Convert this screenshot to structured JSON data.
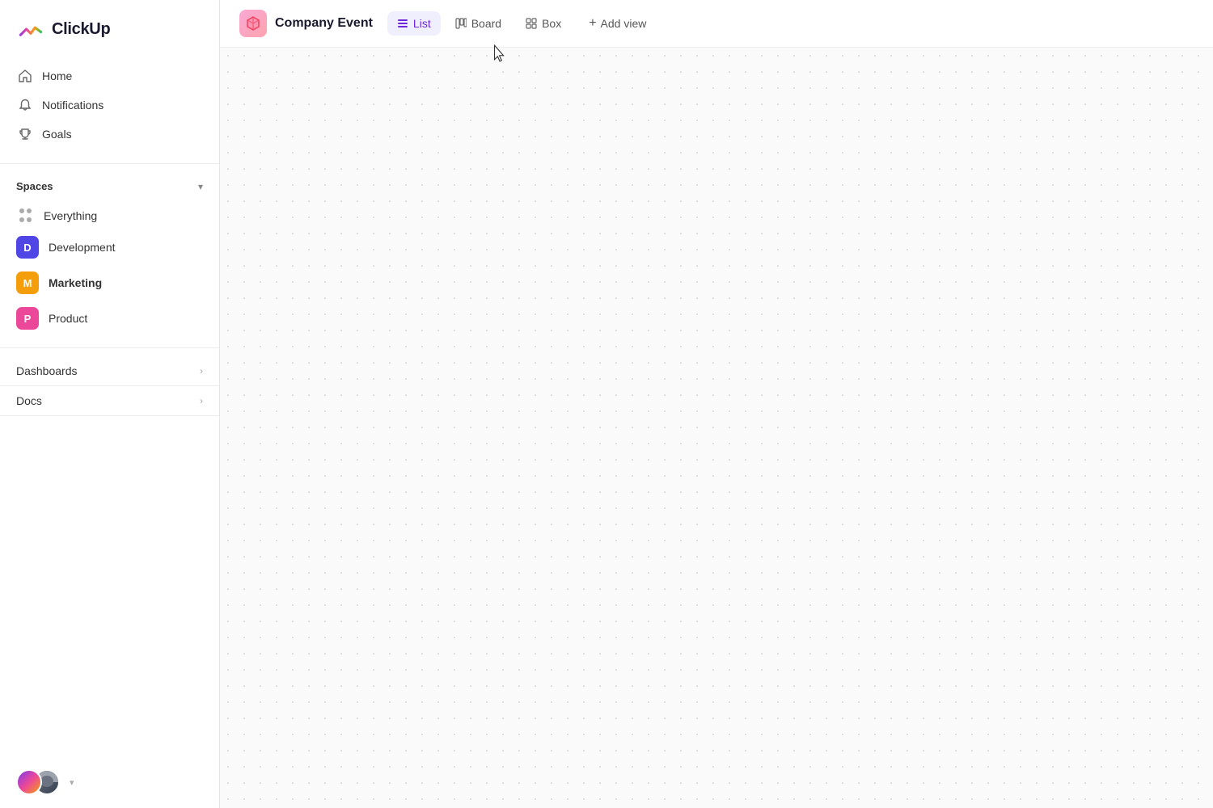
{
  "app": {
    "name": "ClickUp"
  },
  "sidebar": {
    "nav": [
      {
        "id": "home",
        "label": "Home",
        "icon": "home-icon"
      },
      {
        "id": "notifications",
        "label": "Notifications",
        "icon": "bell-icon"
      },
      {
        "id": "goals",
        "label": "Goals",
        "icon": "trophy-icon"
      }
    ],
    "spaces": {
      "title": "Spaces",
      "items": [
        {
          "id": "everything",
          "label": "Everything",
          "type": "dots"
        },
        {
          "id": "development",
          "label": "Development",
          "color": "#4f46e5",
          "initial": "D"
        },
        {
          "id": "marketing",
          "label": "Marketing",
          "color": "#f59e0b",
          "initial": "M",
          "active": true
        },
        {
          "id": "product",
          "label": "Product",
          "color": "#ec4899",
          "initial": "P"
        }
      ]
    },
    "sections": [
      {
        "id": "dashboards",
        "label": "Dashboards"
      },
      {
        "id": "docs",
        "label": "Docs"
      }
    ]
  },
  "topbar": {
    "project_name": "Company Event",
    "tabs": [
      {
        "id": "list",
        "label": "List",
        "active": true
      },
      {
        "id": "board",
        "label": "Board",
        "active": false
      },
      {
        "id": "box",
        "label": "Box",
        "active": false
      }
    ],
    "add_view_label": "Add view"
  },
  "colors": {
    "accent_purple": "#6d28d9",
    "tab_active_bg": "#f0effe"
  }
}
